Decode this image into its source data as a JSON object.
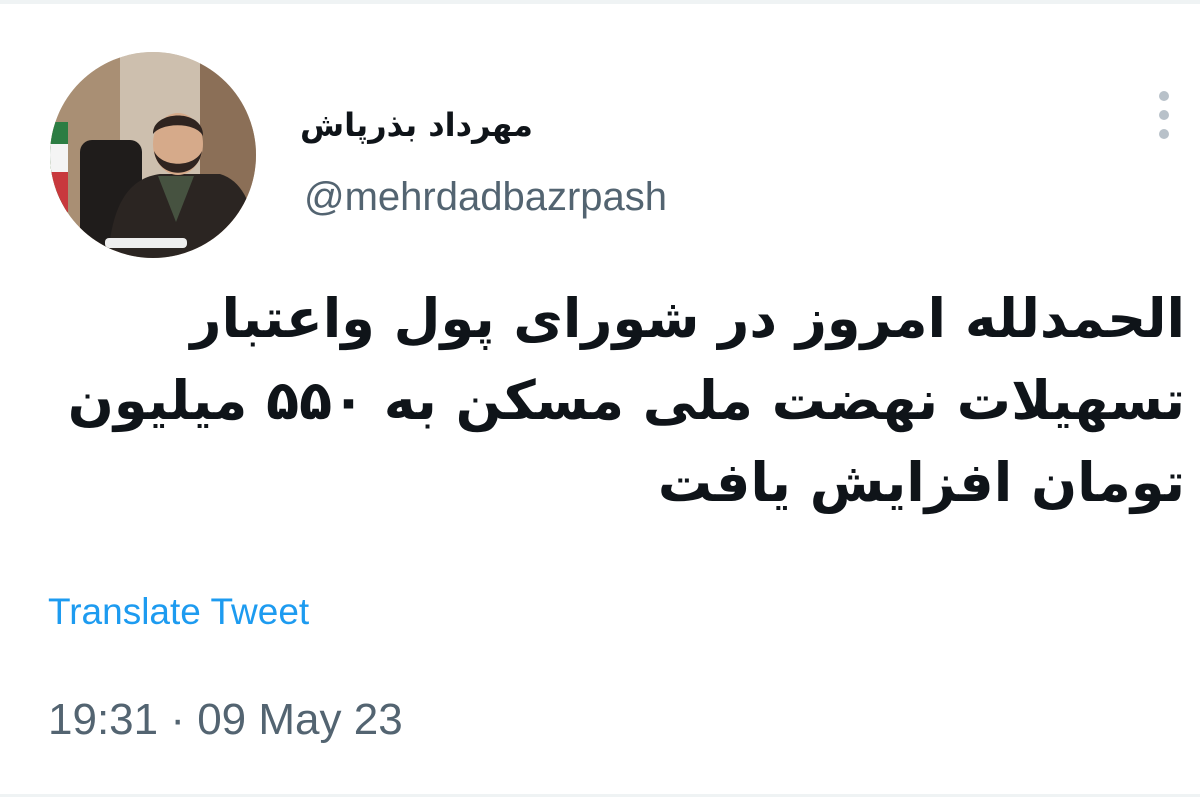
{
  "tweet": {
    "author": {
      "display_name": "مهرداد بذرپاش",
      "handle": "@mehrdadbazrpash",
      "avatar": "profile-photo"
    },
    "more_icon": "more-vertical-icon",
    "text": "الحمدلله امروز در شورای پول واعتبار تسهیلات نهضت ملی مسکن به ۵۵۰ میلیون تومان افزایش یافت",
    "translate_label": "Translate Tweet",
    "timestamp": "19:31 · 09 May 23"
  },
  "colors": {
    "text_primary": "#0f1419",
    "text_secondary": "#536471",
    "link": "#1d9bf0",
    "divider": "#eff3f4"
  }
}
